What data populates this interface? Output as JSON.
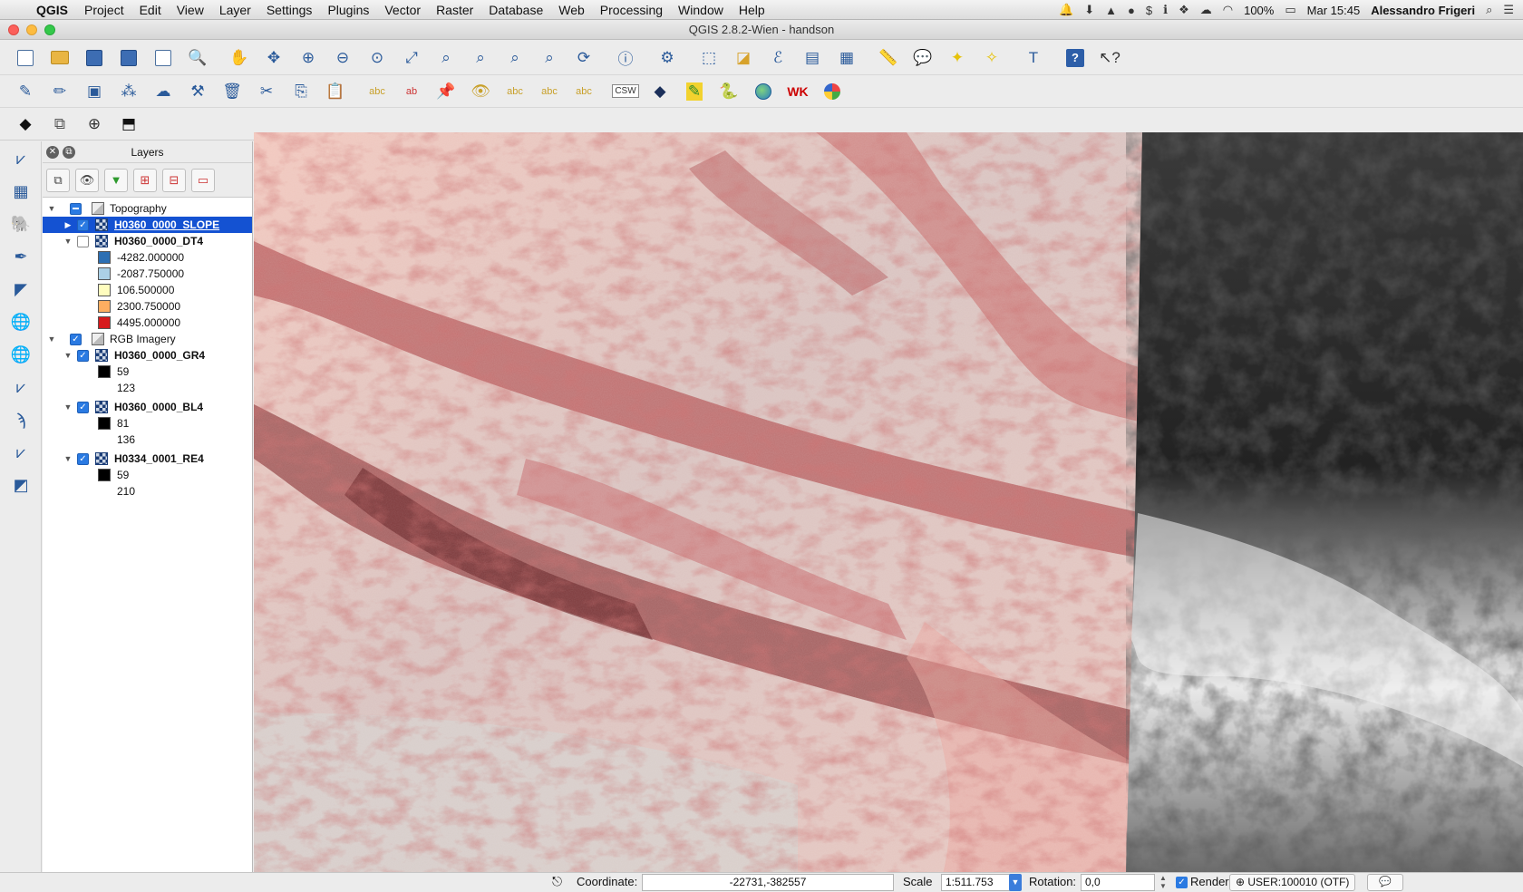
{
  "menubar": {
    "app_name": "QGIS",
    "menus": [
      "Project",
      "Edit",
      "View",
      "Layer",
      "Settings",
      "Plugins",
      "Vector",
      "Raster",
      "Database",
      "Web",
      "Processing",
      "Window",
      "Help"
    ],
    "battery": "100%",
    "clock": "Mar 15:45",
    "user": "Alessandro Frigeri"
  },
  "window": {
    "title": "QGIS 2.8.2-Wien - handson"
  },
  "layers_panel": {
    "title": "Layers",
    "tree": {
      "topography_group": "Topography",
      "slope_layer": "H0360_0000_SLOPE",
      "dt4_layer": "H0360_0000_DT4",
      "dt4_legend": [
        "-4282.000000",
        "-2087.750000",
        "106.500000",
        "2300.750000",
        "4495.000000"
      ],
      "rgb_group": "RGB Imagery",
      "gr4_layer": "H0360_0000_GR4",
      "gr4_min": "59",
      "gr4_max": "123",
      "bl4_layer": "H0360_0000_BL4",
      "bl4_min": "81",
      "bl4_max": "136",
      "re4_layer": "H0334_0001_RE4",
      "re4_min": "59",
      "re4_max": "210"
    },
    "legend_colors": [
      "#2c6fb3",
      "#abd0e6",
      "#fffdbe",
      "#fdae61",
      "#d7191c"
    ]
  },
  "statusbar": {
    "coordinate_label": "Coordinate:",
    "coordinate_value": "-22731,-382557",
    "scale_label": "Scale",
    "scale_value": "1:511.753",
    "rotation_label": "Rotation:",
    "rotation_value": "0,0",
    "render_label": "Render",
    "crs_value": "USER:100010 (OTF)"
  }
}
